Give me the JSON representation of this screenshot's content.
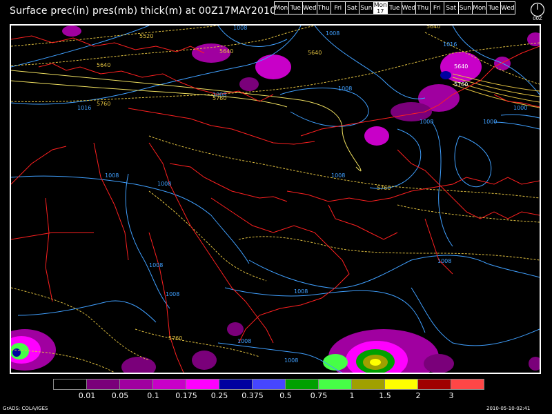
{
  "title": "Surface prec(in) pres(mb) thick(m) at 00Z17MAY2010",
  "days": [
    {
      "label": "Mon"
    },
    {
      "label": "Tue"
    },
    {
      "label": "Wed"
    },
    {
      "label": "Thu"
    },
    {
      "label": "Fri"
    },
    {
      "label": "Sat"
    },
    {
      "label": "Sun"
    },
    {
      "label": "Mon",
      "num": "17",
      "selected": true
    },
    {
      "label": "Tue"
    },
    {
      "label": "Wed"
    },
    {
      "label": "Thu"
    },
    {
      "label": "Fri"
    },
    {
      "label": "Sat"
    },
    {
      "label": "Sun"
    },
    {
      "label": "Mon"
    },
    {
      "label": "Tue"
    },
    {
      "label": "Wed"
    }
  ],
  "clock_label": "00Z",
  "colorbar": {
    "colors": [
      "#000000",
      "#7a007a",
      "#a000a0",
      "#c800c8",
      "#ff00ff",
      "#0000a0",
      "#4646ff",
      "#00a000",
      "#46ff46",
      "#a0a000",
      "#ffff00",
      "#a00000",
      "#ff4646"
    ],
    "labels": [
      "0.01",
      "0.05",
      "0.1",
      "0.175",
      "0.25",
      "0.375",
      "0.5",
      "0.75",
      "1",
      "1.5",
      "2",
      "3"
    ]
  },
  "map_labels": {
    "pressure": [
      "1008",
      "1008",
      "1008",
      "1016",
      "1016",
      "1008",
      "1008",
      "1008",
      "1008",
      "1008",
      "1008",
      "1000",
      "1000",
      "1016"
    ],
    "thickness": [
      "5520",
      "5640",
      "5640",
      "5640",
      "5640",
      "5760",
      "5760",
      "5760",
      "5760",
      "5640",
      "5760"
    ]
  },
  "footer_left": "GrADS: COLA/IGES",
  "footer_right": "2010-05-10-02:41",
  "colors": {
    "pressure_contour": "#40a0ff",
    "thickness_contour": "#e0c040",
    "border": "#ff2020",
    "frame": "#ffffff"
  }
}
